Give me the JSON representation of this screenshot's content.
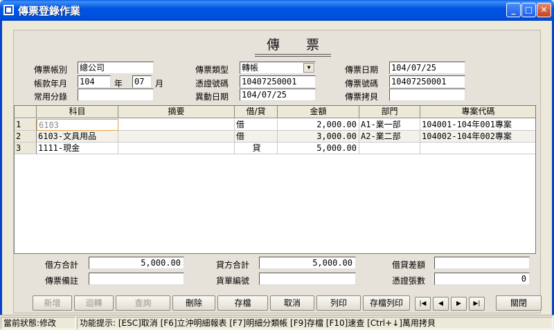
{
  "window": {
    "title": "傳票登錄作業"
  },
  "form": {
    "title": "傳 票",
    "labels": {
      "account": "傳票帳別",
      "year_month": "帳款年月",
      "year_unit": "年",
      "month_unit": "月",
      "common_entry": "常用分錄",
      "voucher_type": "傳票類型",
      "cert_no": "憑證號碼",
      "change_date": "異動日期",
      "voucher_date": "傳票日期",
      "voucher_no": "傳票號碼",
      "voucher_copy": "傳票拷貝"
    },
    "values": {
      "account": "總公司",
      "year": "104",
      "month": "07",
      "common_entry": "",
      "voucher_type": "轉帳",
      "cert_no": "10407250001",
      "change_date": "104/07/25",
      "voucher_date": "104/07/25",
      "voucher_no": "10407250001",
      "voucher_copy": ""
    }
  },
  "grid": {
    "columns": [
      "科目",
      "摘要",
      "借/貸",
      "金額",
      "部門",
      "專案代碼"
    ],
    "rows": [
      {
        "num": "1",
        "subject": "6103",
        "summary": "",
        "dc": "借",
        "amount": "2,000.00",
        "dept": "A1-業一部",
        "project": "104001-104年001專案"
      },
      {
        "num": "2",
        "subject": "6103-文具用品",
        "summary": "",
        "dc": "借",
        "amount": "3,000.00",
        "dept": "A2-業二部",
        "project": "104002-104年002專案"
      },
      {
        "num": "3",
        "subject": "1111-現金",
        "summary": "",
        "dc": "貸",
        "amount": "5,000.00",
        "dept": "",
        "project": ""
      }
    ]
  },
  "totals": {
    "labels": {
      "debit_total": "借方合計",
      "credit_total": "貸方合計",
      "diff": "借貸差額",
      "note": "傳票備註",
      "order_no": "貨單編號",
      "cert_count": "憑證張數"
    },
    "values": {
      "debit_total": "5,000.00",
      "credit_total": "5,000.00",
      "diff": "",
      "note": "",
      "order_no": "",
      "cert_count": "0"
    }
  },
  "buttons": {
    "add": "新增",
    "reverse": "迴轉",
    "query": "查詢",
    "delete": "刪除",
    "save": "存檔",
    "cancel": "取消",
    "print": "列印",
    "save_print": "存檔列印",
    "close": "關閉"
  },
  "status": {
    "state": "當前狀態:修改",
    "hint": "功能提示: [ESC]取消 [F6]立沖明細報表 [F7]明細分類帳 [F9]存檔 [F10]速查 [Ctrl+↓]萬用拷貝"
  }
}
